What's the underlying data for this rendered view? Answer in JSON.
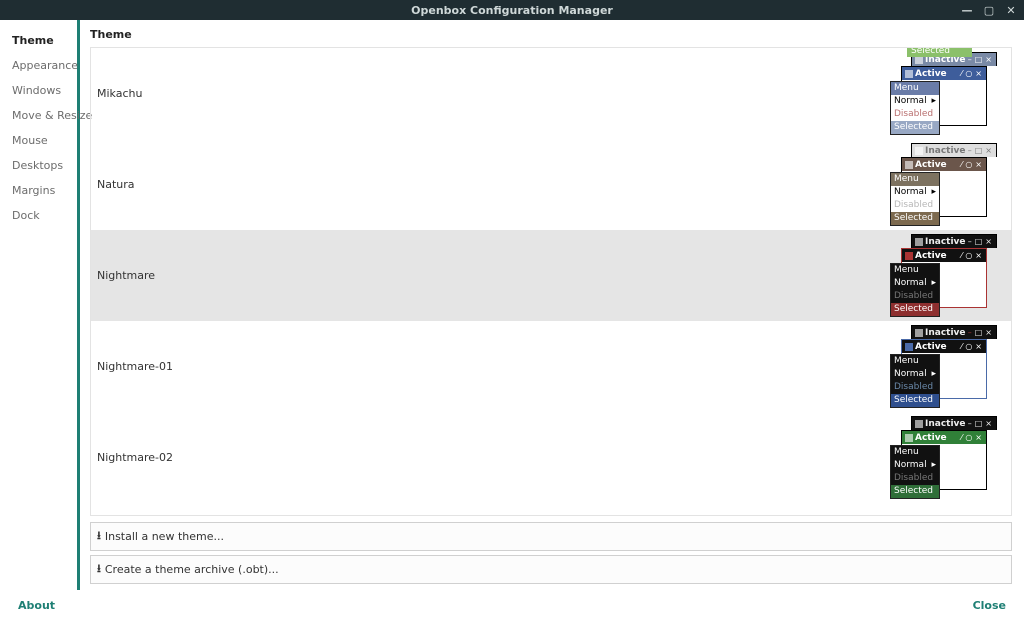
{
  "window": {
    "title": "Openbox Configuration Manager"
  },
  "sidebar": {
    "items": [
      {
        "label": "Theme",
        "active": true
      },
      {
        "label": "Appearance",
        "active": false
      },
      {
        "label": "Windows",
        "active": false
      },
      {
        "label": "Move & Resize",
        "active": false
      },
      {
        "label": "Mouse",
        "active": false
      },
      {
        "label": "Desktops",
        "active": false
      },
      {
        "label": "Margins",
        "active": false
      },
      {
        "label": "Dock",
        "active": false
      }
    ]
  },
  "panel": {
    "title": "Theme"
  },
  "themes": [
    {
      "id": "mikachu",
      "label": "Mikachu",
      "selected": false,
      "preview_class": "pv-mik",
      "show_extra_sel": true
    },
    {
      "id": "natura",
      "label": "Natura",
      "selected": false,
      "preview_class": "pv-nat"
    },
    {
      "id": "nightmare",
      "label": "Nightmare",
      "selected": true,
      "preview_class": "pv-ngh"
    },
    {
      "id": "nightmare01",
      "label": "Nightmare-01",
      "selected": false,
      "preview_class": "pv-n01"
    },
    {
      "id": "nightmare02",
      "label": "Nightmare-02",
      "selected": false,
      "preview_class": "pv-n02"
    }
  ],
  "preview_strings": {
    "inactive": "Inactive",
    "active": "Active",
    "menu": "Menu",
    "normal": "Normal",
    "disabled": "Disabled",
    "selected": "Selected"
  },
  "actions": {
    "install": "Install a new theme...",
    "archive": "Create a theme archive (.obt)..."
  },
  "footer": {
    "about": "About",
    "close": "Close"
  }
}
